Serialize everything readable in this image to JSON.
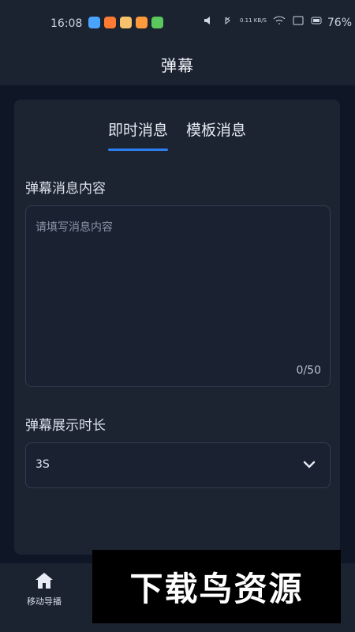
{
  "status_bar": {
    "time": "16:08",
    "battery": "76%",
    "signal_text": "0.11 KB/S",
    "app_icon_colors": [
      "#4aa3ff",
      "#ff7a32",
      "#f7c36a",
      "#ff9a3c",
      "#5ac85a"
    ]
  },
  "header": {
    "title": "弹幕"
  },
  "tabs": [
    {
      "label": "即时消息",
      "active": true
    },
    {
      "label": "模板消息",
      "active": false
    }
  ],
  "message_section": {
    "label": "弹幕消息内容",
    "placeholder": "请填写消息内容",
    "counter": "0/50"
  },
  "duration_section": {
    "label": "弹幕展示时长",
    "selected_value": "3S"
  },
  "bottom_nav": {
    "items": [
      {
        "label": "移动导播",
        "icon": "home-icon"
      }
    ]
  },
  "watermark": {
    "text": "下载鸟资源"
  },
  "colors": {
    "background": "#0f1626",
    "card": "#1c2331",
    "accent": "#2d7ff0"
  }
}
